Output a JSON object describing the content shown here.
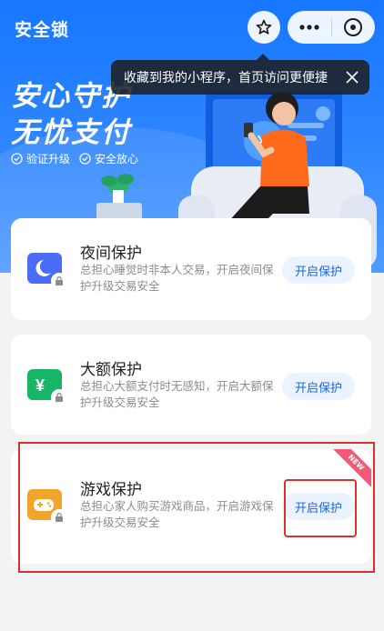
{
  "header": {
    "title": "安全锁",
    "star_icon": "star-icon",
    "more_icon": "more-dots-icon",
    "close_icon": "close-circle-icon"
  },
  "tooltip": {
    "text": "收藏到我的小程序，首页访问更便捷"
  },
  "hero": {
    "slogan_line1": "安心守护",
    "slogan_line2": "无忧支付",
    "tag1": "验证升级",
    "tag2": "安全放心"
  },
  "cards": [
    {
      "title": "夜间保护",
      "desc": "总担心睡觉时非本人交易，开启夜间保护升级交易安全",
      "button": "开启保护",
      "icon": "moon-lock-icon",
      "icon_color": "#4a6cf7"
    },
    {
      "title": "大额保护",
      "desc": "总担心大额支付时无感知，开启大额保护升级交易安全",
      "button": "开启保护",
      "icon": "yen-lock-icon",
      "icon_color": "#18b566"
    },
    {
      "title": "游戏保护",
      "desc": "总担心家人购买游戏商品，开启游戏保护升级交易安全",
      "button": "开启保护",
      "icon": "gamepad-lock-icon",
      "icon_color": "#f2a52b",
      "badge": "NEW"
    }
  ],
  "colors": {
    "brand_blue": "#1677ff",
    "button_bg": "#eaf3ff",
    "button_text": "#1a66e0",
    "annotation_red": "#d9312b"
  }
}
